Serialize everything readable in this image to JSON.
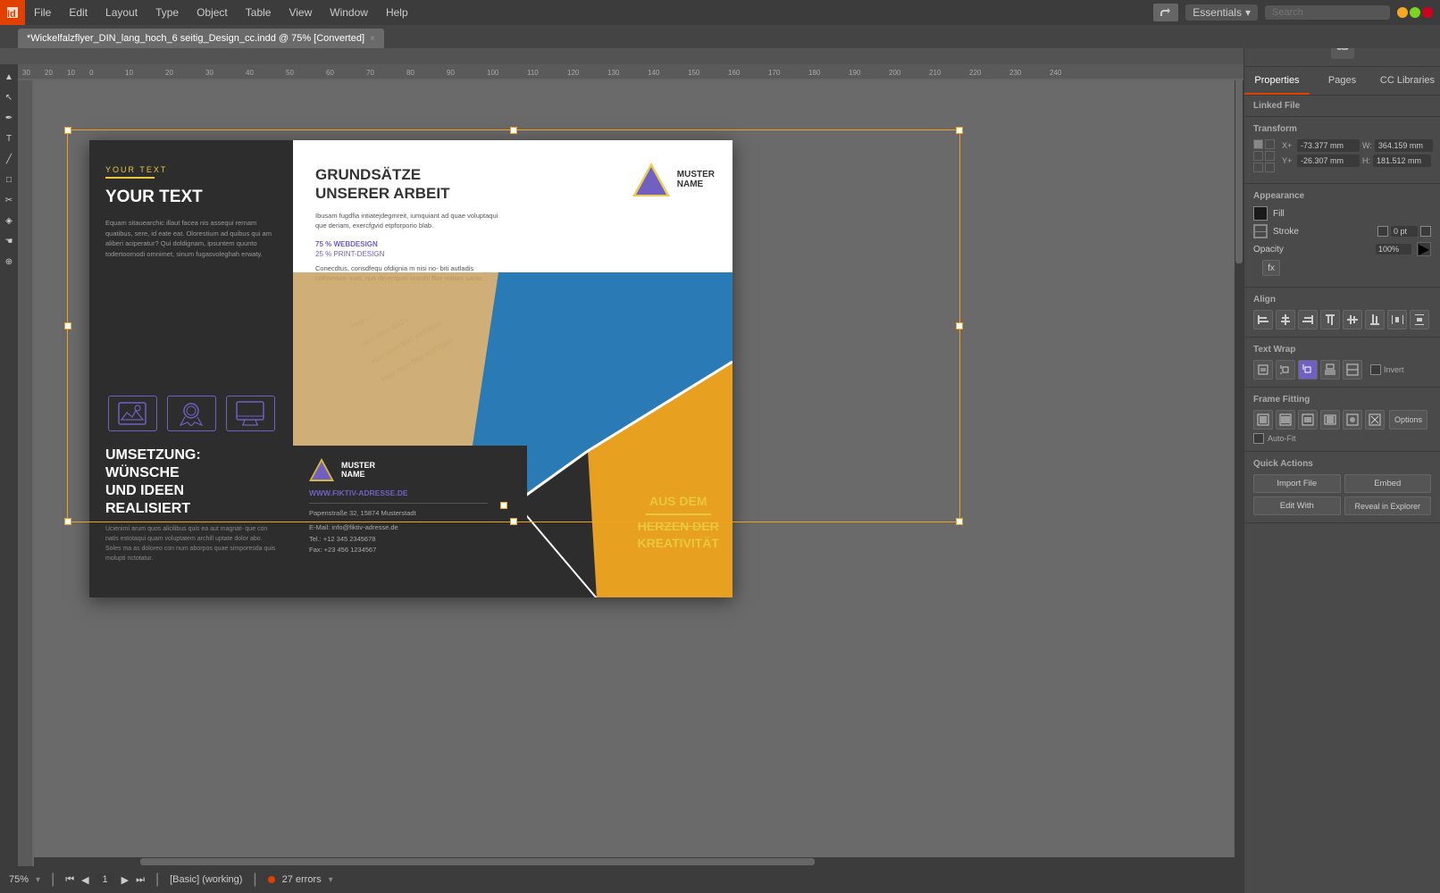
{
  "menubar": {
    "items": [
      "File",
      "Edit",
      "Layout",
      "Type",
      "Object",
      "Table",
      "View",
      "Window",
      "Help"
    ],
    "essentials": "Essentials",
    "search_placeholder": "Search"
  },
  "tab": {
    "label": "*Wickelfalzflyer_DIN_lang_hoch_6 seitig_Design_cc.indd @ 75% [Converted]",
    "close": "×"
  },
  "statusbar": {
    "zoom": "75%",
    "zoom_arrow": "▾",
    "nav_first": "⏮",
    "nav_prev": "◀",
    "page": "1",
    "nav_next": "▶",
    "nav_last": "⏭",
    "layout": "[Basic] (working)",
    "errors": "27 errors",
    "preflight": "▾"
  },
  "properties_panel": {
    "tabs": [
      "Properties",
      "Pages",
      "CC Libraries"
    ],
    "linked_file": "Linked File",
    "transform": {
      "title": "Transform",
      "x_label": "X+",
      "x_value": "-73.377 mm",
      "w_label": "W:",
      "w_value": "364.159 mm",
      "y_label": "Y+",
      "y_value": "-26.307 mm",
      "h_label": "H:",
      "h_value": "181.512 mm"
    },
    "appearance": {
      "title": "Appearance",
      "fill_label": "Fill",
      "stroke_label": "Stroke",
      "stroke_value": "0 pt",
      "opacity_label": "Opacity",
      "opacity_value": "100%",
      "fx_label": "fx"
    },
    "align": {
      "title": "Align"
    },
    "text_wrap": {
      "title": "Text Wrap",
      "invert_label": "Invert"
    },
    "frame_fitting": {
      "title": "Frame Fitting",
      "options_label": "Options",
      "auto_fit_label": "Auto-Fit"
    },
    "quick_actions": {
      "title": "Quick Actions",
      "import_file": "Import File",
      "embed": "Embed",
      "edit_with": "Edit With",
      "reveal_in_explorer": "Reveal in Explorer"
    }
  },
  "document": {
    "left_panel": {
      "top_label": "YOUR TEXT",
      "body1": "Equam sitauearchic illaut facea nis assequi rernam quatibus, sere, id eate eat. Olorestium ad quibus qui am aliberi aciperatur? Qui doldignam, ipsuntem quunto todertoornodi omnimet, sinum fugasvoleghah erwaty.",
      "icons": [
        "landscape-icon",
        "badge-icon",
        "monitor-icon"
      ],
      "umsetzung_title": "UMSETZUNG:\nWÜNSCHE\nUND IDEEN\nREALISIERT",
      "umsetzung_body": "Ucienimí arum quos alicilibus quis ea aut magnat- que con natis estotaqui quam voluptatem archill uptate dolor abo. Soles ma as doloreo con num aborpos quae simporesda quis molupti nctotatur."
    },
    "right_panel": {
      "grundsatze_title": "GRUNDSÄTZE\nUNSERER ARBEIT",
      "grundsatze_body": "Ibusam fugdfia intiatejdegmreit, iumquiant ad quae voluptaqui que deriam, exercfgvid etpforporio blab.",
      "percent1": "75 % WEBDESIGN",
      "percent2": "25 % PRINT-DESIGN",
      "percent_body": "Conecdtus, consdfequ ofdignia m nisi no- biti autladis cofnserum num, nus derempori omnihi fllor militan santo.",
      "muster_name": "MUSTER\nNAME",
      "watermark": "Hier dein Bild einfügen",
      "contact": {
        "muster_name": "MUSTER\nNAME",
        "website": "WWW.FIKTIV-ADRESSE.DE",
        "address": "Papenstraße 32, 15874 Musterstadt",
        "email": "E-Mail: info@fiktiv-adresse.de",
        "tel": "Tel.: +12 345 2345678",
        "fax": "Fax: +23 456 1234567"
      },
      "aus_dem": "AUS DEM\nHERZEN DER\nKREATIVITÄT"
    }
  },
  "colors": {
    "accent_yellow": "#e8c840",
    "accent_purple": "#7060c0",
    "dark_panel": "#2d2d2d",
    "blue_shape": "#2a7ab5",
    "orange_shape": "#e8a020",
    "tan_shape": "#c8a060",
    "dark_shape": "#333333"
  }
}
